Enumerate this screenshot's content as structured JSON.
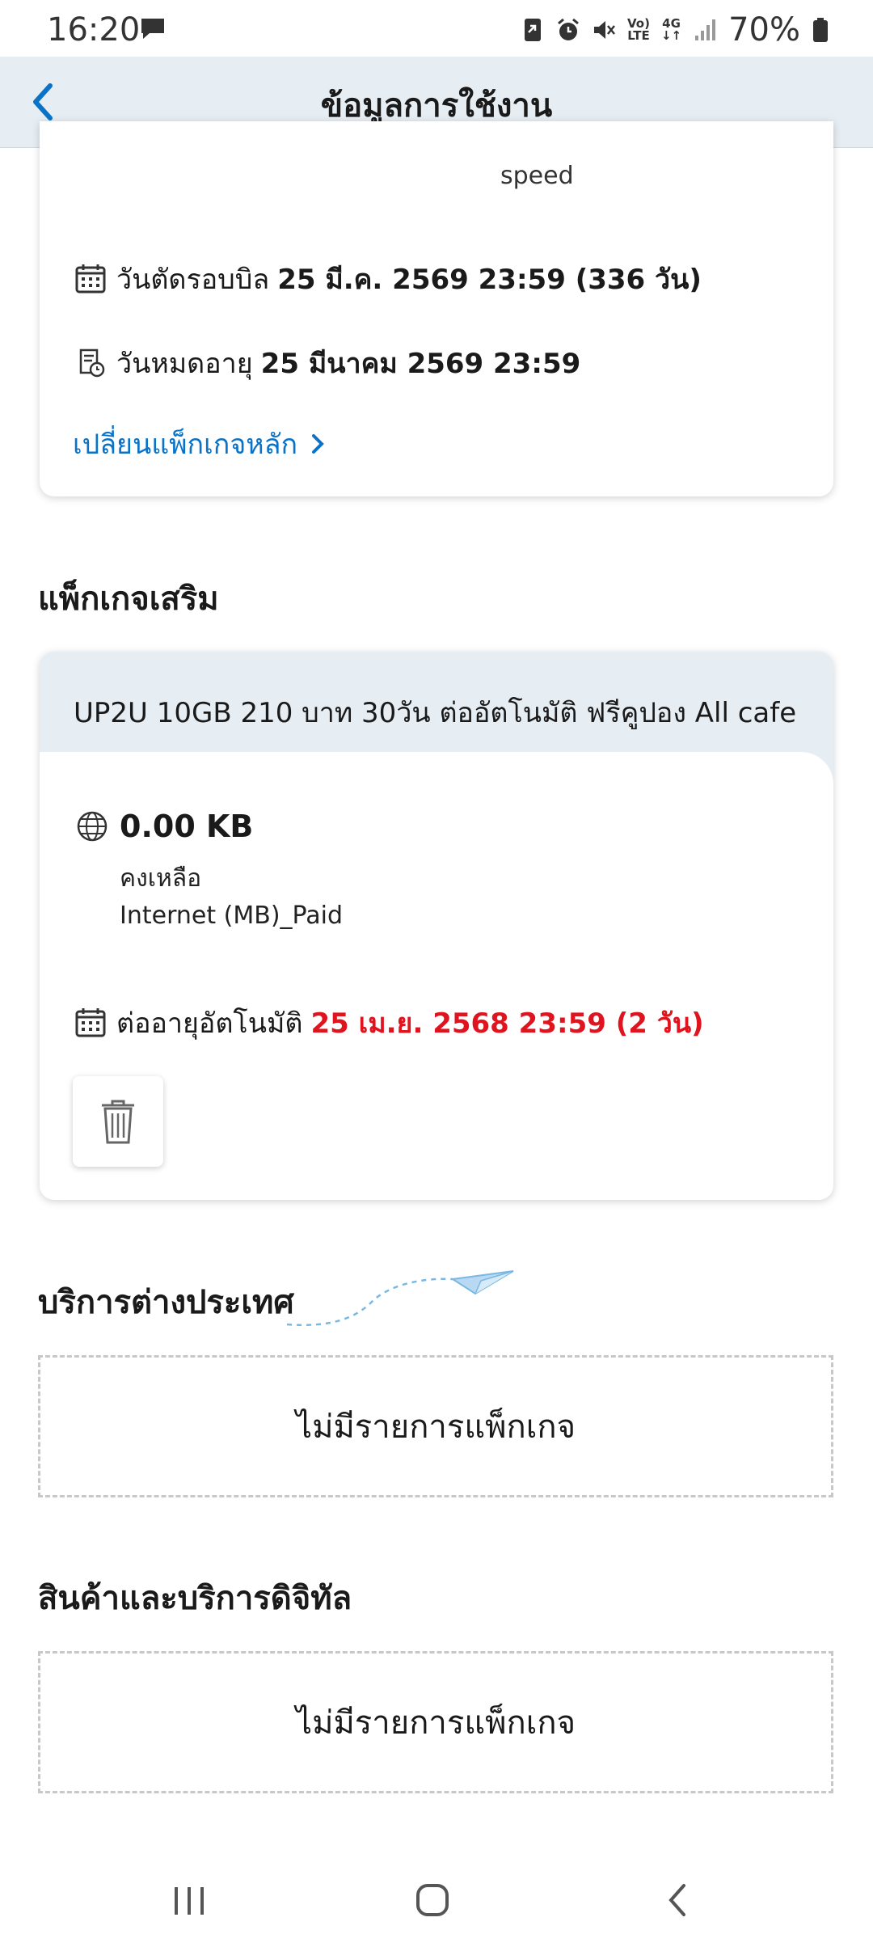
{
  "status_bar": {
    "time": "16:20",
    "battery": "70%",
    "volte_label_top": "Vo)",
    "volte_label_bottom": "LTE",
    "network": "4G"
  },
  "header": {
    "title": "ข้อมูลการใช้งาน"
  },
  "main_package": {
    "speed_text": "speed",
    "billing_label": "วันตัดรอบบิล",
    "billing_value": "25 มี.ค. 2569 23:59 (336 วัน)",
    "expiry_label": "วันหมดอายุ",
    "expiry_value": "25 มีนาคม 2569 23:59",
    "change_link": "เปลี่ยนแพ็กเกจหลัก"
  },
  "addon_section": {
    "title": "แพ็กเกจเสริม",
    "package_name": "UP2U 10GB 210 บาท 30วัน ต่ออัตโนมัติ ฟรีคูปอง All cafe",
    "balance_value": "0.00 KB",
    "balance_label": "คงเหลือ",
    "balance_type": "Internet (MB)_Paid",
    "renew_label": "ต่ออายุอัตโนมัติ",
    "renew_value": "25 เม.ย. 2568 23:59 (2 วัน)"
  },
  "international_section": {
    "title": "บริการต่างประเทศ",
    "empty_text": "ไม่มีรายการแพ็กเกจ"
  },
  "digital_section": {
    "title": "สินค้าและบริการดิจิทัล",
    "empty_text": "ไม่มีรายการแพ็กเกจ"
  },
  "colors": {
    "accent": "#0b73c7",
    "header_bg": "#e6edf3",
    "alert": "#e0141e"
  }
}
